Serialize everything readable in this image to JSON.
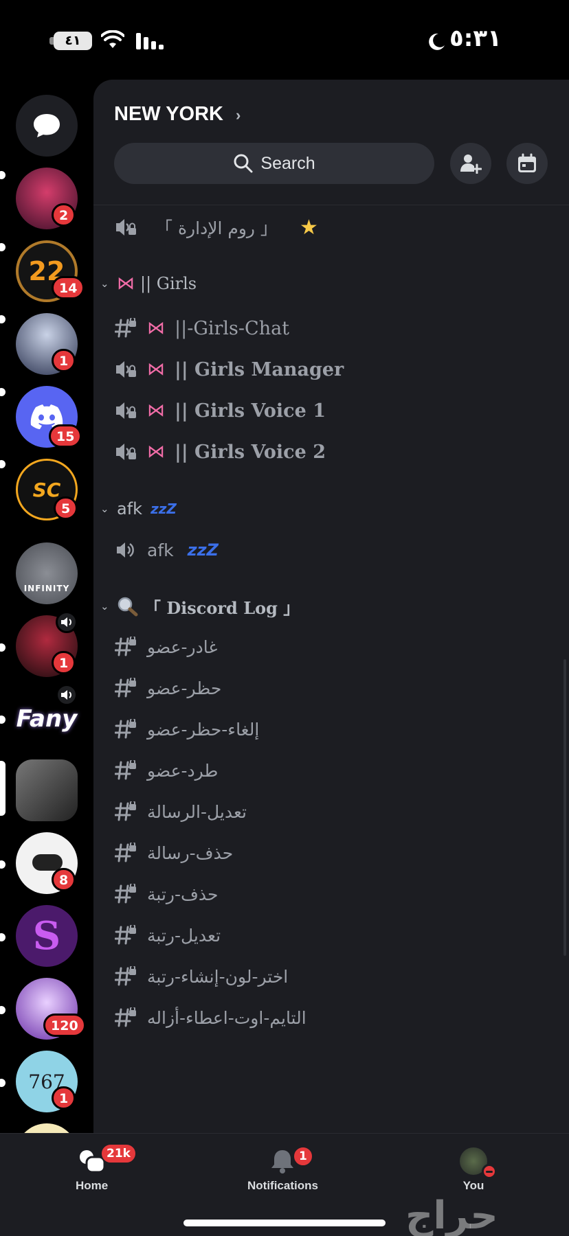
{
  "status": {
    "time": "٥:٣١",
    "battery": "٤١"
  },
  "server": {
    "name": "NEW YORK"
  },
  "search": {
    "label": "Search"
  },
  "rail": {
    "servers": [
      {
        "id": "dm",
        "badge": ""
      },
      {
        "id": "s1",
        "badge": "2",
        "color": "#7a1f3d"
      },
      {
        "id": "s2",
        "badge": "14",
        "color": "#1a1a1a",
        "text": "22"
      },
      {
        "id": "s3",
        "badge": "1",
        "color": "#3a4a6b"
      },
      {
        "id": "s4",
        "badge": "15",
        "color": "#5865f2"
      },
      {
        "id": "s5",
        "badge": "5",
        "color": "#111111",
        "text": "SC"
      },
      {
        "id": "s6",
        "badge": "",
        "color": "#6d7077",
        "text": "INFINITY"
      },
      {
        "id": "s7",
        "badge": "1",
        "color": "#2a1a1a"
      },
      {
        "id": "s8",
        "badge": "",
        "color": "#3b2d5a",
        "text": "Fany"
      },
      {
        "id": "s9",
        "badge": "",
        "color": "#555555"
      },
      {
        "id": "s10",
        "badge": "8",
        "color": "#f2f2f2"
      },
      {
        "id": "s11",
        "badge": "",
        "color": "#4b1a6b"
      },
      {
        "id": "s12",
        "badge": "120",
        "color": "#7d4fa8"
      },
      {
        "id": "s13",
        "badge": "1",
        "color": "#8fd3e6",
        "text": "767"
      }
    ]
  },
  "channels": {
    "admin_room": "「 روم الإدارة 」",
    "girls_category": "|| Girls",
    "girls_chat": "||-Girls-Chat",
    "girls_manager": "|| Girls  Manager",
    "girls_voice1": "|| Girls Voice 1",
    "girls_voice2": "|| Girls Voice 2",
    "afk_category": "afk",
    "afk_channel": "afk",
    "zzz": "zzZ",
    "log_category": "「 Discord Log 」",
    "log_channels": [
      "غادر-عضو",
      "حظر-عضو",
      "إلغاء-حظر-عضو",
      "طرد-عضو",
      "تعديل-الرسالة",
      "حذف-رسالة",
      "حذف-رتبة",
      "تعديل-رتبة",
      "اختر-لون-إنشاء-رتبة",
      "التايم-اوت-اعطاء-أزاله"
    ]
  },
  "nav": {
    "home": "Home",
    "home_badge": "21k",
    "notifications": "Notifications",
    "notifications_badge": "1",
    "you": "You"
  },
  "watermark": "حراج",
  "colors": {
    "badge": "#e5383b",
    "panel": "#1c1d22",
    "blurple": "#5865f2"
  }
}
